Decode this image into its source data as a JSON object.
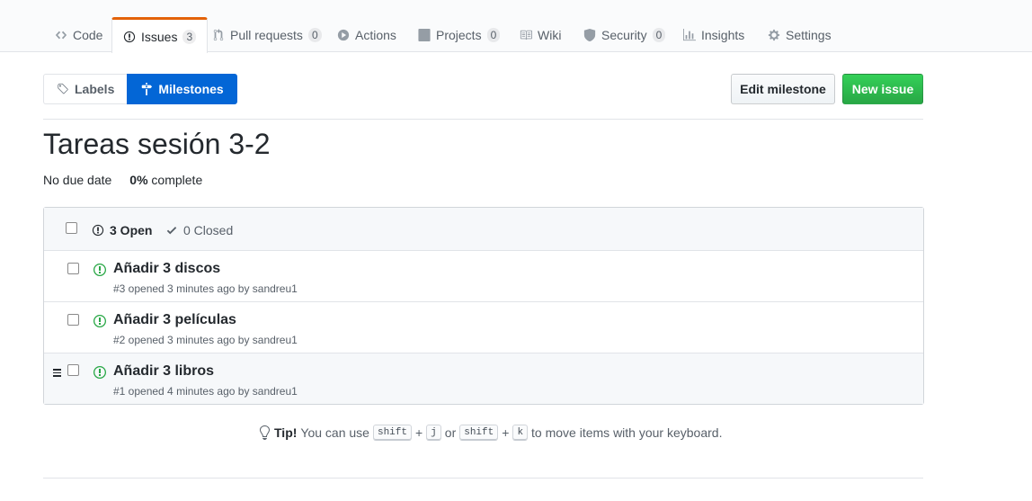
{
  "reponav": {
    "tabs": [
      {
        "label": "Code",
        "icon": "code-icon",
        "counter": null
      },
      {
        "label": "Issues",
        "icon": "issue-opened-icon",
        "counter": "3"
      },
      {
        "label": "Pull requests",
        "icon": "git-pull-request-icon",
        "counter": "0"
      },
      {
        "label": "Actions",
        "icon": "play-icon",
        "counter": null
      },
      {
        "label": "Projects",
        "icon": "project-icon",
        "counter": "0"
      },
      {
        "label": "Wiki",
        "icon": "book-icon",
        "counter": null
      },
      {
        "label": "Security",
        "icon": "shield-icon",
        "counter": "0"
      },
      {
        "label": "Insights",
        "icon": "graph-icon",
        "counter": null
      },
      {
        "label": "Settings",
        "icon": "gear-icon",
        "counter": null
      }
    ],
    "selected": "Issues"
  },
  "subnav": {
    "labels": "Labels",
    "milestones": "Milestones"
  },
  "actions": {
    "edit_milestone": "Edit milestone",
    "new_issue": "New issue"
  },
  "milestone": {
    "title": "Tareas sesión 3-2",
    "due": "No due date",
    "percent": "0%",
    "complete_label": "complete"
  },
  "issues_header": {
    "open": "3 Open",
    "closed": "0 Closed"
  },
  "issues": [
    {
      "title": "Añadir 3 discos",
      "meta": "#3 opened 3 minutes ago by sandreu1"
    },
    {
      "title": "Añadir 3 películas",
      "meta": "#2 opened 3 minutes ago by sandreu1"
    },
    {
      "title": "Añadir 3 libros",
      "meta": "#1 opened 4 minutes ago by sandreu1"
    }
  ],
  "tip": {
    "lead": "Tip!",
    "text1": "You can use",
    "key_shift": "shift",
    "plus": "+",
    "key_j": "j",
    "or": "or",
    "key_k": "k",
    "text2": "to move items with your keyboard."
  },
  "colors": {
    "accent": "#0366d6",
    "green": "#28a745",
    "tab_border": "#e36209"
  }
}
